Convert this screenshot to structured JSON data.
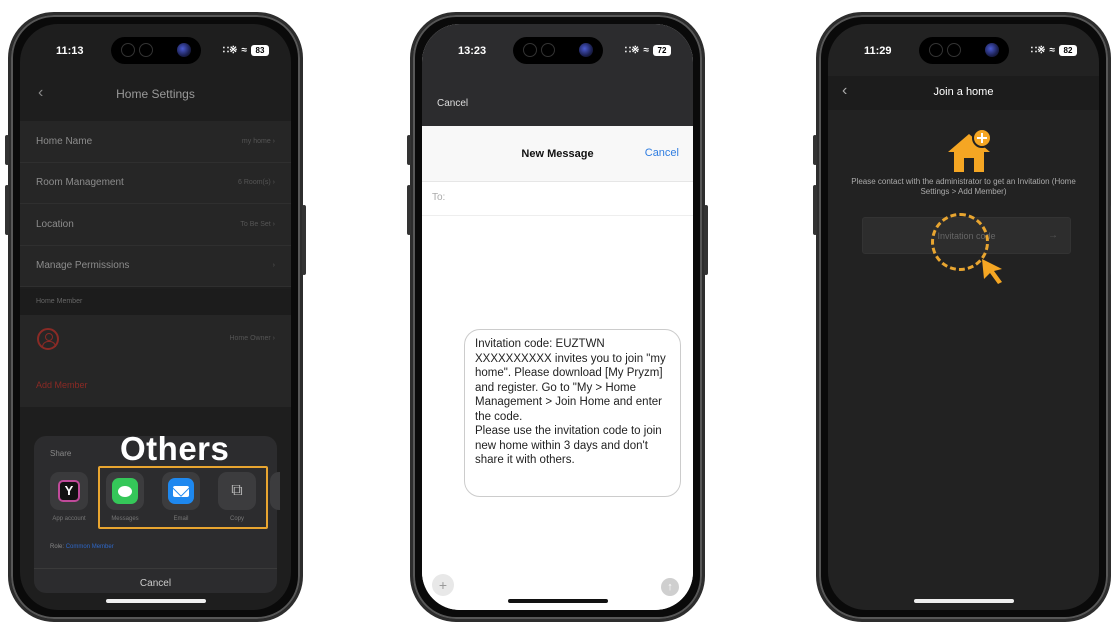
{
  "phone1": {
    "status_time": "11:13",
    "battery": "83",
    "nav_title": "Home Settings",
    "back_icon": "chevron-left-icon",
    "settings": [
      {
        "label": "Home Name",
        "value": "my home"
      },
      {
        "label": "Room Management",
        "value": "6 Room(s)"
      },
      {
        "label": "Location",
        "value": "To Be Set"
      },
      {
        "label": "Manage Permissions",
        "value": ""
      }
    ],
    "home_member_header": "Home Member",
    "owner_role": "Home Owner",
    "add_member": "Add Member",
    "share": {
      "title": "Share",
      "others_label": "Others",
      "apps": [
        {
          "label": "App account",
          "icon": "app-logo-icon"
        },
        {
          "label": "Messages",
          "icon": "messages-icon"
        },
        {
          "label": "Email",
          "icon": "email-icon"
        },
        {
          "label": "Copy",
          "icon": "copy-icon"
        }
      ],
      "role_prefix": "Role:",
      "role_value": "Common Member",
      "cancel": "Cancel"
    },
    "colors": {
      "highlight": "#e8a530",
      "add_member": "#8a2a25"
    }
  },
  "phone2": {
    "status_time": "13:23",
    "battery": "72",
    "top_cancel": "Cancel",
    "title": "New Message",
    "cancel": "Cancel",
    "to_label": "To:",
    "message": "Invitation code: EUZTWN\nXXXXXXXXXX   invites you to join \"my home\". Please download [My Pryzm] and register. Go to \"My > Home Management > Join Home and enter the code.\nPlease use the invitation code to join new home within 3 days and don't share it with others.",
    "colors": {
      "link": "#2f7de1"
    }
  },
  "phone3": {
    "status_time": "11:29",
    "battery": "82",
    "nav_title": "Join a home",
    "instruction": "Please contact with the administrator to get an Invitation (Home Settings > Add Member)",
    "code_placeholder": "Invitation code",
    "colors": {
      "icon": "#f5a623"
    }
  }
}
